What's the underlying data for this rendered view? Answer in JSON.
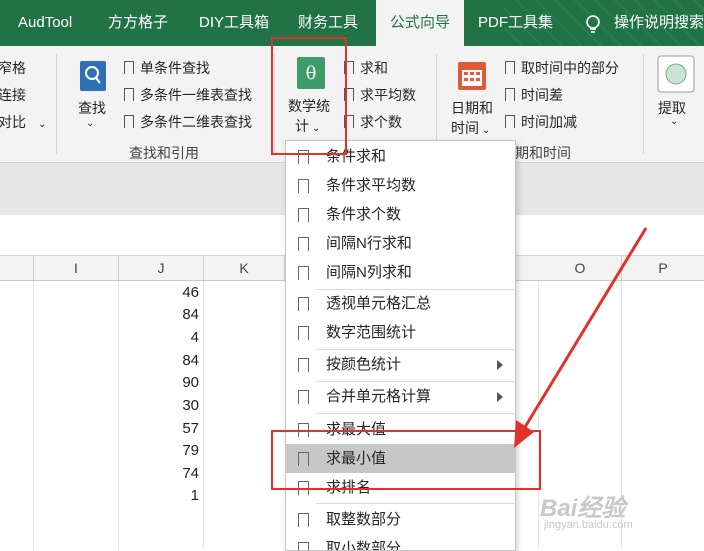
{
  "tabs": [
    "AudTool",
    "方方格子",
    "DIY工具箱",
    "财务工具",
    "公式向导",
    "PDF工具集",
    "操作说明搜索"
  ],
  "ribbon": {
    "left_cut": [
      "窄格",
      "连接",
      "对比"
    ],
    "lookup_button": "查找",
    "lookup_items": [
      "单条件查找",
      "多条件一维表查找",
      "多条件二维表查找"
    ],
    "lookup_group": "查找和引用",
    "math_button_line1": "数学统",
    "math_button_line2": "计",
    "math_items": [
      "求和",
      "求平均数",
      "求个数"
    ],
    "date_button_line1": "日期和",
    "date_button_line2": "时间",
    "date_items": [
      "取时间中的部分",
      "时间差",
      "时间加减"
    ],
    "date_group": "期和时间",
    "extract_button": "提取",
    "accent": "#217346"
  },
  "columns": [
    "I",
    "J",
    "K",
    "O",
    "P"
  ],
  "column_j_values": [
    "46",
    "84",
    "4",
    "84",
    "90",
    "30",
    "57",
    "79",
    "74",
    "1"
  ],
  "menu": {
    "items": [
      {
        "label": "条件求和",
        "submenu": false
      },
      {
        "label": "条件求平均数",
        "submenu": false
      },
      {
        "label": "条件求个数",
        "submenu": false
      },
      {
        "label": "间隔N行求和",
        "submenu": false
      },
      {
        "label": "间隔N列求和",
        "submenu": false
      },
      {
        "label": "透视单元格汇总",
        "submenu": false
      },
      {
        "label": "数字范围统计",
        "submenu": false
      },
      {
        "label": "按颜色统计",
        "submenu": true
      },
      {
        "label": "合并单元格计算",
        "submenu": true
      },
      {
        "label": "求最大值",
        "submenu": false
      },
      {
        "label": "求最小值",
        "submenu": false,
        "highlighted": true
      },
      {
        "label": "求排名",
        "submenu": false
      },
      {
        "label": "取整数部分",
        "submenu": false
      },
      {
        "label": "取小数部分",
        "submenu": false
      }
    ]
  },
  "annotation_color": "#e0322b",
  "watermark": {
    "brand": "Bai经验",
    "url": "jingyan.baidu.com"
  }
}
